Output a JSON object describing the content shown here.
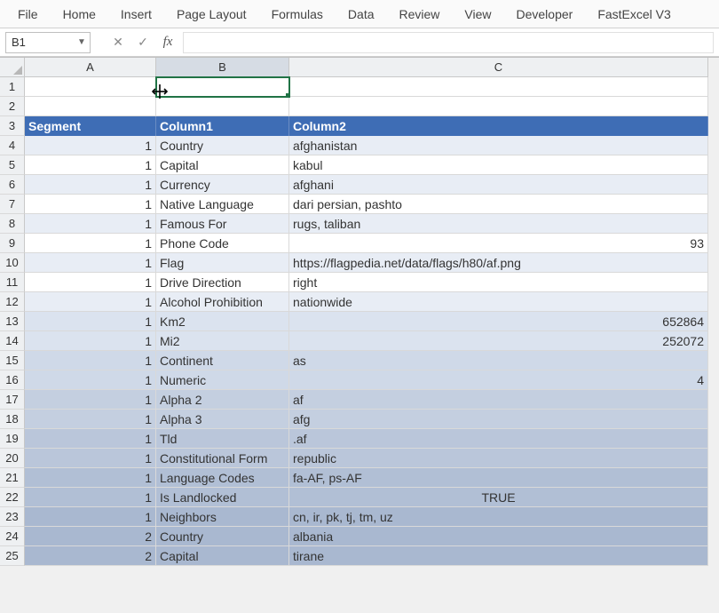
{
  "ribbon": {
    "tabs": [
      "File",
      "Home",
      "Insert",
      "Page Layout",
      "Formulas",
      "Data",
      "Review",
      "View",
      "Developer",
      "FastExcel V3"
    ]
  },
  "formula_bar": {
    "name_box": "B1",
    "fx_label": "fx",
    "formula": ""
  },
  "columns": [
    "A",
    "B",
    "C"
  ],
  "selected_column": "B",
  "table": {
    "header_row": 3,
    "headers": [
      "Segment",
      "Column1",
      "Column2"
    ],
    "rows": [
      {
        "r": 4,
        "seg": "1",
        "c1": "Country",
        "c2": "afghanistan",
        "align": "left",
        "band": 0
      },
      {
        "r": 5,
        "seg": "1",
        "c1": "Capital",
        "c2": "kabul",
        "align": "left",
        "band": 1
      },
      {
        "r": 6,
        "seg": "1",
        "c1": "Currency",
        "c2": "afghani",
        "align": "left",
        "band": 0
      },
      {
        "r": 7,
        "seg": "1",
        "c1": "Native Language",
        "c2": "dari persian, pashto",
        "align": "left",
        "band": 1
      },
      {
        "r": 8,
        "seg": "1",
        "c1": "Famous For",
        "c2": "rugs, taliban",
        "align": "left",
        "band": 0
      },
      {
        "r": 9,
        "seg": "1",
        "c1": "Phone Code",
        "c2": "93",
        "align": "right",
        "band": 1
      },
      {
        "r": 10,
        "seg": "1",
        "c1": "Flag",
        "c2": "https://flagpedia.net/data/flags/h80/af.png",
        "align": "left",
        "band": 0
      },
      {
        "r": 11,
        "seg": "1",
        "c1": "Drive Direction",
        "c2": "right",
        "align": "left",
        "band": 1
      },
      {
        "r": 12,
        "seg": "1",
        "c1": "Alcohol Prohibition",
        "c2": "nationwide",
        "align": "left",
        "band": 0
      },
      {
        "r": 13,
        "seg": "1",
        "c1": "Km2",
        "c2": "652864",
        "align": "right",
        "band": 2
      },
      {
        "r": 14,
        "seg": "1",
        "c1": "Mi2",
        "c2": "252072",
        "align": "right",
        "band": 2
      },
      {
        "r": 15,
        "seg": "1",
        "c1": "Continent",
        "c2": "as",
        "align": "left",
        "band": 3
      },
      {
        "r": 16,
        "seg": "1",
        "c1": "Numeric",
        "c2": "4",
        "align": "right",
        "band": 3
      },
      {
        "r": 17,
        "seg": "1",
        "c1": "Alpha 2",
        "c2": "af",
        "align": "left",
        "band": 4
      },
      {
        "r": 18,
        "seg": "1",
        "c1": "Alpha 3",
        "c2": "afg",
        "align": "left",
        "band": 4
      },
      {
        "r": 19,
        "seg": "1",
        "c1": "Tld",
        "c2": ".af",
        "align": "left",
        "band": 5
      },
      {
        "r": 20,
        "seg": "1",
        "c1": "Constitutional Form",
        "c2": "republic",
        "align": "left",
        "band": 5
      },
      {
        "r": 21,
        "seg": "1",
        "c1": "Language Codes",
        "c2": "fa-AF, ps-AF",
        "align": "left",
        "band": 6
      },
      {
        "r": 22,
        "seg": "1",
        "c1": "Is Landlocked",
        "c2": "TRUE",
        "align": "center",
        "band": 6
      },
      {
        "r": 23,
        "seg": "1",
        "c1": "Neighbors",
        "c2": "cn, ir, pk, tj, tm, uz",
        "align": "left",
        "band": 7
      },
      {
        "r": 24,
        "seg": "2",
        "c1": "Country",
        "c2": "albania",
        "align": "left",
        "band": 7
      },
      {
        "r": 25,
        "seg": "2",
        "c1": "Capital",
        "c2": "tirane",
        "align": "left",
        "band": 7
      }
    ]
  },
  "active_cell": {
    "col": "B",
    "row": 1
  }
}
